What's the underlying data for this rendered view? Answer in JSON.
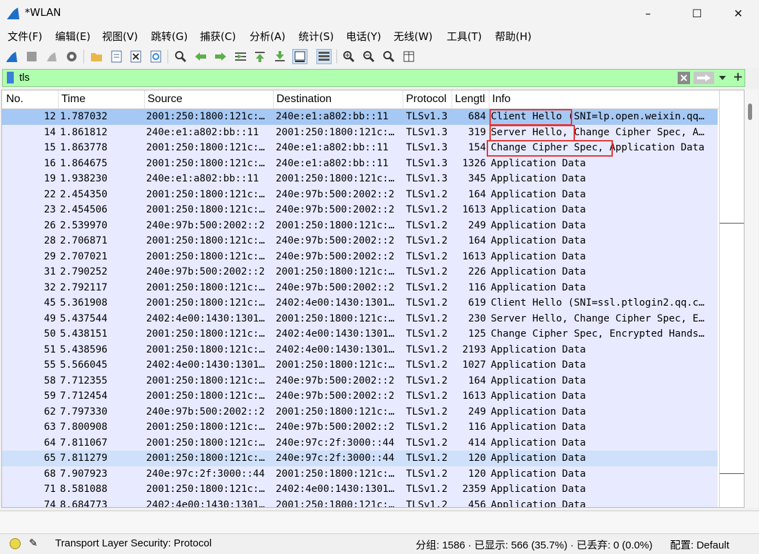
{
  "window": {
    "title": "*WLAN",
    "min": "–",
    "max": "☐",
    "close": "✕"
  },
  "menu": [
    "文件(F)",
    "编辑(E)",
    "视图(V)",
    "跳转(G)",
    "捕获(C)",
    "分析(A)",
    "统计(S)",
    "电话(Y)",
    "无线(W)",
    "工具(T)",
    "帮助(H)"
  ],
  "toolbar_icons": [
    "shark-fin-start-icon",
    "stop-capture-icon",
    "restart-capture-icon",
    "capture-options-icon",
    "open-file-icon",
    "save-file-icon",
    "close-file-icon",
    "reload-file-icon",
    "find-packet-icon",
    "go-back-icon",
    "go-forward-icon",
    "go-to-packet-icon",
    "go-first-packet-icon",
    "go-last-packet-icon",
    "auto-scroll-icon",
    "colorize-icon",
    "zoom-in-icon",
    "zoom-out-icon",
    "normal-size-icon",
    "resize-columns-icon"
  ],
  "filter": {
    "value": "tls"
  },
  "columns": {
    "no": "No.",
    "time": "Time",
    "source": "Source",
    "destination": "Destination",
    "protocol": "Protocol",
    "length": "Lengtl",
    "info": "Info"
  },
  "packets": [
    {
      "no": "12",
      "time": "1.787032",
      "src": "2001:250:1800:121c:…",
      "dst": "240e:e1:a802:bb::11",
      "proto": "TLSv1.3",
      "len": "684",
      "info": "Client Hello (SNI=lp.open.weixin.qq…"
    },
    {
      "no": "14",
      "time": "1.861812",
      "src": "240e:e1:a802:bb::11",
      "dst": "2001:250:1800:121c:…",
      "proto": "TLSv1.3",
      "len": "319",
      "info": "Server Hello, Change Cipher Spec, A…"
    },
    {
      "no": "15",
      "time": "1.863778",
      "src": "2001:250:1800:121c:…",
      "dst": "240e:e1:a802:bb::11",
      "proto": "TLSv1.3",
      "len": "154",
      "info": "Change Cipher Spec, Application Data"
    },
    {
      "no": "16",
      "time": "1.864675",
      "src": "2001:250:1800:121c:…",
      "dst": "240e:e1:a802:bb::11",
      "proto": "TLSv1.3",
      "len": "1326",
      "info": "Application Data"
    },
    {
      "no": "19",
      "time": "1.938230",
      "src": "240e:e1:a802:bb::11",
      "dst": "2001:250:1800:121c:…",
      "proto": "TLSv1.3",
      "len": "345",
      "info": "Application Data"
    },
    {
      "no": "22",
      "time": "2.454350",
      "src": "2001:250:1800:121c:…",
      "dst": "240e:97b:500:2002::2",
      "proto": "TLSv1.2",
      "len": "164",
      "info": "Application Data"
    },
    {
      "no": "23",
      "time": "2.454506",
      "src": "2001:250:1800:121c:…",
      "dst": "240e:97b:500:2002::2",
      "proto": "TLSv1.2",
      "len": "1613",
      "info": "Application Data"
    },
    {
      "no": "26",
      "time": "2.539970",
      "src": "240e:97b:500:2002::2",
      "dst": "2001:250:1800:121c:…",
      "proto": "TLSv1.2",
      "len": "249",
      "info": "Application Data"
    },
    {
      "no": "28",
      "time": "2.706871",
      "src": "2001:250:1800:121c:…",
      "dst": "240e:97b:500:2002::2",
      "proto": "TLSv1.2",
      "len": "164",
      "info": "Application Data"
    },
    {
      "no": "29",
      "time": "2.707021",
      "src": "2001:250:1800:121c:…",
      "dst": "240e:97b:500:2002::2",
      "proto": "TLSv1.2",
      "len": "1613",
      "info": "Application Data"
    },
    {
      "no": "31",
      "time": "2.790252",
      "src": "240e:97b:500:2002::2",
      "dst": "2001:250:1800:121c:…",
      "proto": "TLSv1.2",
      "len": "226",
      "info": "Application Data"
    },
    {
      "no": "32",
      "time": "2.792117",
      "src": "2001:250:1800:121c:…",
      "dst": "240e:97b:500:2002::2",
      "proto": "TLSv1.2",
      "len": "116",
      "info": "Application Data"
    },
    {
      "no": "45",
      "time": "5.361908",
      "src": "2001:250:1800:121c:…",
      "dst": "2402:4e00:1430:1301…",
      "proto": "TLSv1.2",
      "len": "619",
      "info": "Client Hello (SNI=ssl.ptlogin2.qq.c…"
    },
    {
      "no": "49",
      "time": "5.437544",
      "src": "2402:4e00:1430:1301…",
      "dst": "2001:250:1800:121c:…",
      "proto": "TLSv1.2",
      "len": "230",
      "info": "Server Hello, Change Cipher Spec, E…"
    },
    {
      "no": "50",
      "time": "5.438151",
      "src": "2001:250:1800:121c:…",
      "dst": "2402:4e00:1430:1301…",
      "proto": "TLSv1.2",
      "len": "125",
      "info": "Change Cipher Spec, Encrypted Hands…"
    },
    {
      "no": "51",
      "time": "5.438596",
      "src": "2001:250:1800:121c:…",
      "dst": "2402:4e00:1430:1301…",
      "proto": "TLSv1.2",
      "len": "2193",
      "info": "Application Data"
    },
    {
      "no": "55",
      "time": "5.566045",
      "src": "2402:4e00:1430:1301…",
      "dst": "2001:250:1800:121c:…",
      "proto": "TLSv1.2",
      "len": "1027",
      "info": "Application Data"
    },
    {
      "no": "58",
      "time": "7.712355",
      "src": "2001:250:1800:121c:…",
      "dst": "240e:97b:500:2002::2",
      "proto": "TLSv1.2",
      "len": "164",
      "info": "Application Data"
    },
    {
      "no": "59",
      "time": "7.712454",
      "src": "2001:250:1800:121c:…",
      "dst": "240e:97b:500:2002::2",
      "proto": "TLSv1.2",
      "len": "1613",
      "info": "Application Data"
    },
    {
      "no": "62",
      "time": "7.797330",
      "src": "240e:97b:500:2002::2",
      "dst": "2001:250:1800:121c:…",
      "proto": "TLSv1.2",
      "len": "249",
      "info": "Application Data"
    },
    {
      "no": "63",
      "time": "7.800908",
      "src": "2001:250:1800:121c:…",
      "dst": "240e:97b:500:2002::2",
      "proto": "TLSv1.2",
      "len": "116",
      "info": "Application Data"
    },
    {
      "no": "64",
      "time": "7.811067",
      "src": "2001:250:1800:121c:…",
      "dst": "240e:97c:2f:3000::44",
      "proto": "TLSv1.2",
      "len": "414",
      "info": "Application Data"
    },
    {
      "no": "65",
      "time": "7.811279",
      "src": "2001:250:1800:121c:…",
      "dst": "240e:97c:2f:3000::44",
      "proto": "TLSv1.2",
      "len": "120",
      "info": "Application Data"
    },
    {
      "no": "68",
      "time": "7.907923",
      "src": "240e:97c:2f:3000::44",
      "dst": "2001:250:1800:121c:…",
      "proto": "TLSv1.2",
      "len": "120",
      "info": "Application Data"
    },
    {
      "no": "71",
      "time": "8.581088",
      "src": "2001:250:1800:121c:…",
      "dst": "2402:4e00:1430:1301…",
      "proto": "TLSv1.2",
      "len": "2359",
      "info": "Application Data"
    },
    {
      "no": "74",
      "time": "8.684773",
      "src": "2402:4e00:1430:1301…",
      "dst": "2001:250:1800:121c:…",
      "proto": "TLSv1.2",
      "len": "456",
      "info": "Application Data"
    }
  ],
  "annotations": [
    "Client Hello",
    "Server Hello,",
    "Change Cipher Spec,"
  ],
  "status": {
    "layer": "Transport Layer Security: Protocol",
    "counts": "分组: 1586 · 已显示: 566 (35.7%) · 已丢弃: 0 (0.0%)",
    "profile": "配置: Default"
  },
  "colors": {
    "filter_valid": "#afffaf",
    "row_bg": "#e8ebff",
    "selected": "#a6c8f4",
    "annotation": "#e53535"
  }
}
